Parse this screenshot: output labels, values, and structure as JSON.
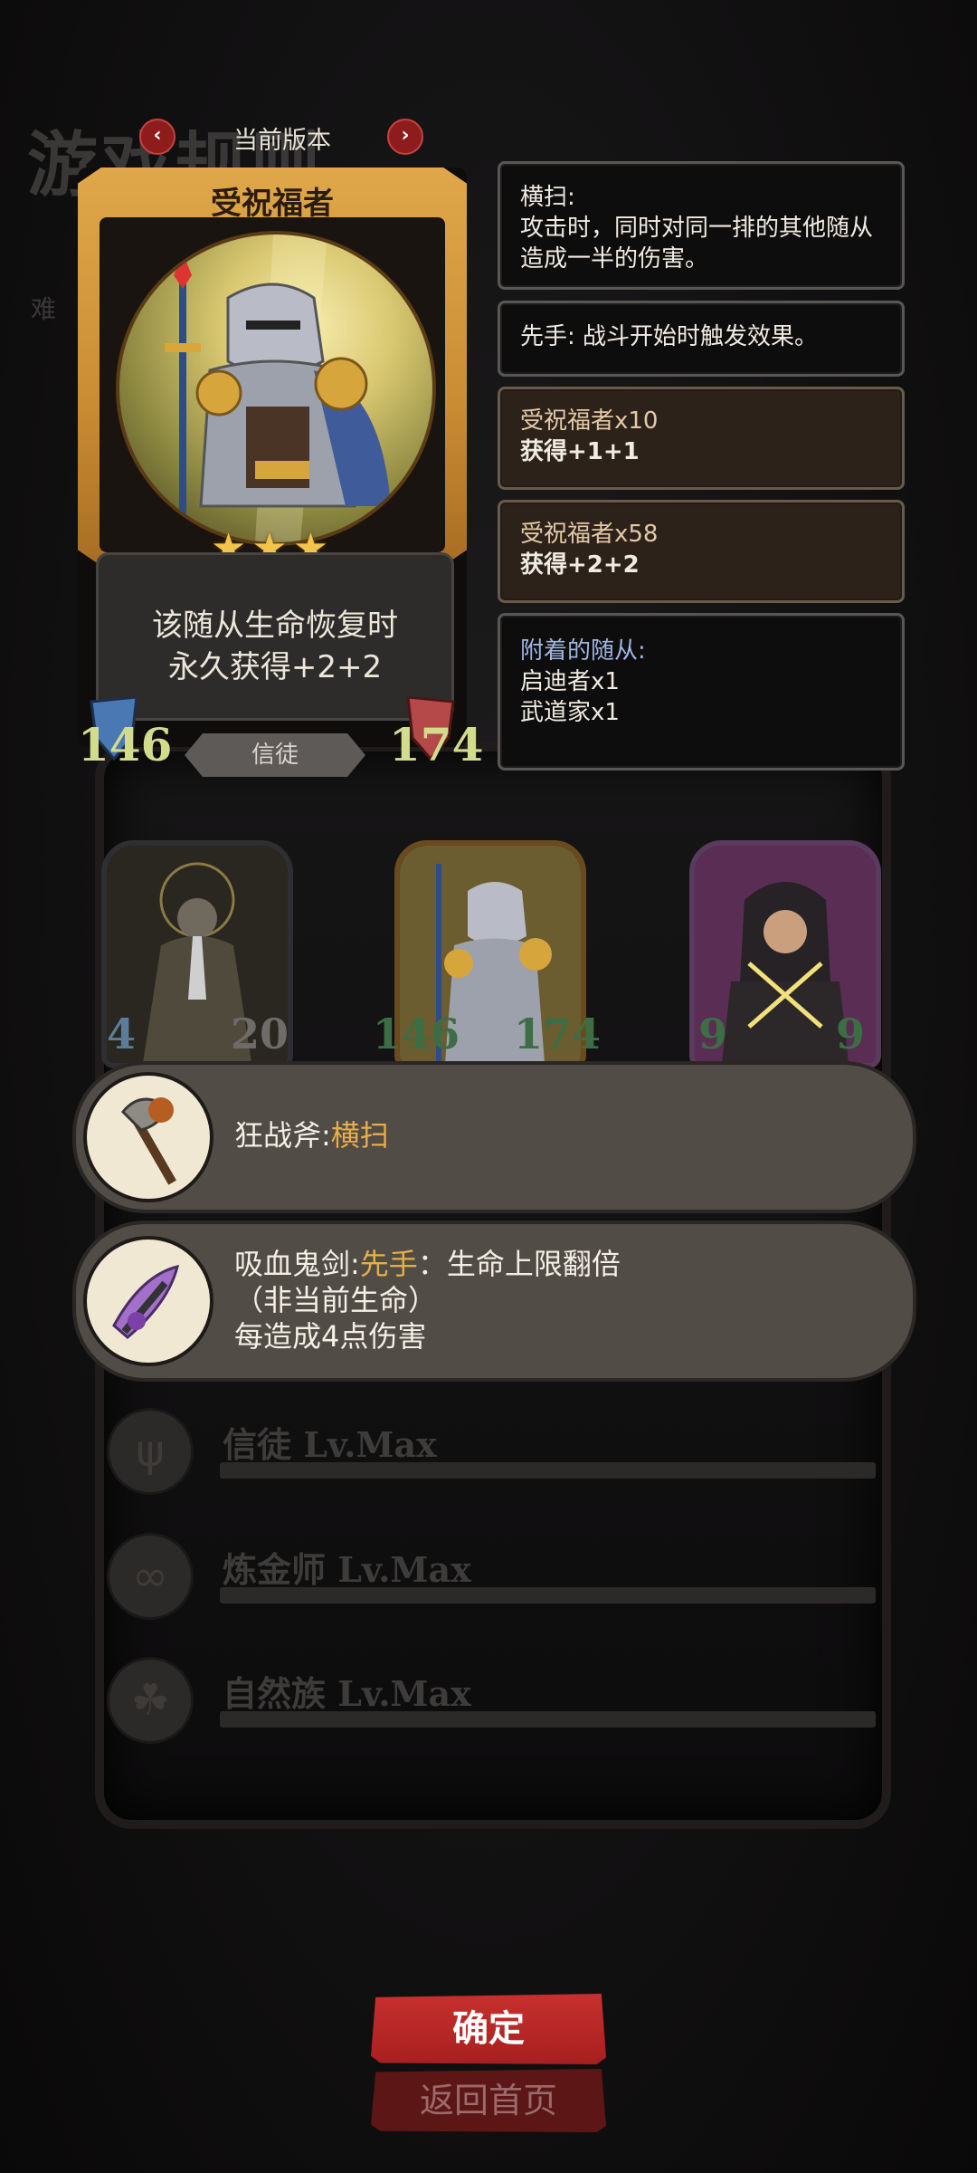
{
  "background": {
    "title": "游戏规则",
    "side_text": "难"
  },
  "version": {
    "label": "当前版本"
  },
  "hero_card": {
    "name": "受祝福者",
    "stars": "★★★",
    "desc_line1": "该随从生命恢复时",
    "desc_line2": "永久获得+2+2",
    "attack": "146",
    "health": "174",
    "tribe": "信徒"
  },
  "info_boxes": [
    {
      "title": "横扫:",
      "body": "攻击时，同时对同一排的其他随从造成一半的伤害。"
    },
    {
      "text": "先手: 战斗开始时触发效果。"
    },
    {
      "title": "受祝福者x10",
      "body": "获得+1+1"
    },
    {
      "title": "受祝福者x58",
      "body": "获得+2+2"
    },
    {
      "title": "附着的随从:",
      "line1": "启迪者x1",
      "line2": "武道家x1"
    }
  ],
  "board": {
    "minions": [
      {
        "attack": "4",
        "health": "20"
      },
      {
        "attack": "146",
        "health": "174"
      },
      {
        "attack": "9",
        "health": "9"
      }
    ]
  },
  "equipment": [
    {
      "name": "狂战斧:",
      "keyword": "横扫",
      "rest": ""
    },
    {
      "name": "吸血鬼剑:",
      "keyword": "先手",
      "rest": "：生命上限翻倍",
      "line2": "（非当前生命）",
      "line3": "每造成4点伤害"
    }
  ],
  "tribes": [
    {
      "name": "信徒 Lv.Max",
      "icon": "pray-icon"
    },
    {
      "name": "炼金师 Lv.Max",
      "icon": "alchemy-icon"
    },
    {
      "name": "自然族 Lv.Max",
      "icon": "nature-icon"
    }
  ],
  "buttons": {
    "confirm": "确定",
    "home": "返回首页"
  },
  "colors": {
    "accent_gold": "#e7ae4a",
    "button_red": "#c8302e",
    "attack_green": "#d3dc8c",
    "blue_text": "#9fb6e2"
  }
}
